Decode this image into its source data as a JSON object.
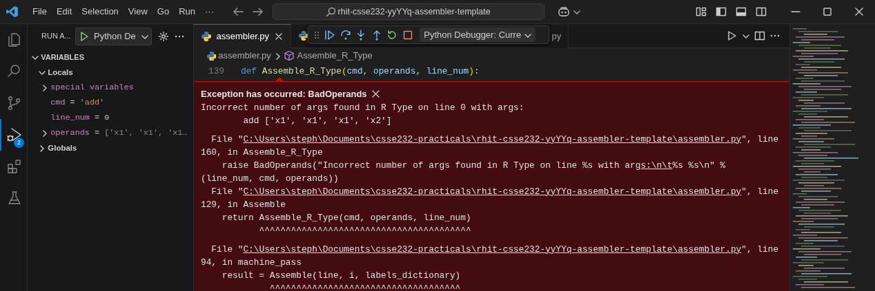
{
  "title_bar": {
    "menu": [
      "File",
      "Edit",
      "Selection",
      "View",
      "Go",
      "Run",
      "···"
    ],
    "search": "rhit-csse232-yyYYq-assembler-template"
  },
  "activity_bar": {
    "items": [
      {
        "kind": "explorer",
        "selected": false
      },
      {
        "kind": "search",
        "selected": false
      },
      {
        "kind": "source-control",
        "selected": false
      },
      {
        "kind": "run-debug",
        "selected": true,
        "badge": "2"
      },
      {
        "kind": "extensions",
        "selected": false
      },
      {
        "kind": "testing",
        "selected": false
      }
    ]
  },
  "sidebar": {
    "title": "RUN A...",
    "config": "Python De",
    "section": {
      "title": "VARIABLES",
      "expanded": true,
      "scopes": [
        {
          "label": "Locals",
          "expanded": true,
          "children": [
            {
              "name": "special variables",
              "expanded": false
            },
            {
              "name": "cmd",
              "sep": "=",
              "value": "'add'",
              "kind": "string"
            },
            {
              "name": "line_num",
              "sep": "=",
              "value": "0",
              "kind": "number"
            },
            {
              "name": "operands",
              "sep": "=",
              "value": "['x1', 'x1', 'x1…",
              "kind": "list",
              "expanded": false
            }
          ]
        },
        {
          "label": "Globals",
          "expanded": false
        }
      ]
    }
  },
  "tabs": [
    {
      "label": "assembler.py",
      "selected": true,
      "closable": true
    },
    {
      "label": "py",
      "selected": false,
      "closable": false
    }
  ],
  "debug_toolbar": {
    "config": "Python Debugger: Curre"
  },
  "breadcrumb": [
    "assembler.py",
    "Assemble_R_Type"
  ],
  "code_line": {
    "number": "139",
    "tokens": [
      {
        "text": "def",
        "kind": "keyword"
      },
      {
        "text": " Assemble_R_Type",
        "kind": "function"
      },
      {
        "text": "(",
        "kind": "bracket"
      },
      {
        "text": "cmd",
        "kind": "param"
      },
      {
        "text": ", ",
        "kind": "plain"
      },
      {
        "text": "operands",
        "kind": "param"
      },
      {
        "text": ", ",
        "kind": "plain"
      },
      {
        "text": "line_num",
        "kind": "param"
      },
      {
        "text": ")",
        "kind": "bracket"
      },
      {
        "text": ":",
        "kind": "plain"
      }
    ]
  },
  "exception": {
    "title": "Exception has occurred: BadOperands",
    "blocks": [
      [
        [
          {
            "text": "Incorrect number of args found in R Type on line 0 with args:"
          }
        ],
        [
          {
            "text": "        add ['x1', 'x1', 'x1', 'x2']"
          }
        ]
      ],
      [
        [
          {
            "text": "  File \""
          },
          {
            "text": "C:\\Users\\steph\\Documents\\csse232-practicals\\rhit-csse232-yyYYq-assembler-template\\assembler.py",
            "link": true
          },
          {
            "text": "\", line"
          }
        ],
        [
          {
            "text": "160, in Assemble_R_Type"
          }
        ],
        [
          {
            "text": "    raise BadOperands(\"Incorrect number of args found in R Type on line %s with arg"
          },
          {
            "text": "s:\\n\\t",
            "link": true
          },
          {
            "text": "%s %s\\n\" %"
          }
        ],
        [
          {
            "text": "(line_num, cmd, operands))"
          }
        ],
        [
          {
            "text": "  File \""
          },
          {
            "text": "C:\\Users\\steph\\Documents\\csse232-practicals\\rhit-csse232-yyYYq-assembler-template\\assembler.py",
            "link": true
          },
          {
            "text": "\", line"
          }
        ],
        [
          {
            "text": "129, in Assemble"
          }
        ],
        [
          {
            "text": "    return Assemble_R_Type(cmd, operands, line_num)"
          }
        ],
        [
          {
            "text": "           ^^^^^^^^^^^^^^^^^^^^^^^^^^^^^^^^^^^^^^^^"
          }
        ]
      ],
      [
        [
          {
            "text": "  File \""
          },
          {
            "text": "C:\\Users\\steph\\Documents\\csse232-practicals\\rhit-csse232-yyYYq-assembler-template\\assembler.py",
            "link": true
          },
          {
            "text": "\", line"
          }
        ],
        [
          {
            "text": "94, in machine_pass"
          }
        ],
        [
          {
            "text": "    result = Assemble(line, i, labels_dictionary)"
          }
        ],
        [
          {
            "text": "             ^^^^^^^^^^^^^^^^^^^^^^^^^^^^^^^^^^^^"
          }
        ]
      ]
    ]
  }
}
